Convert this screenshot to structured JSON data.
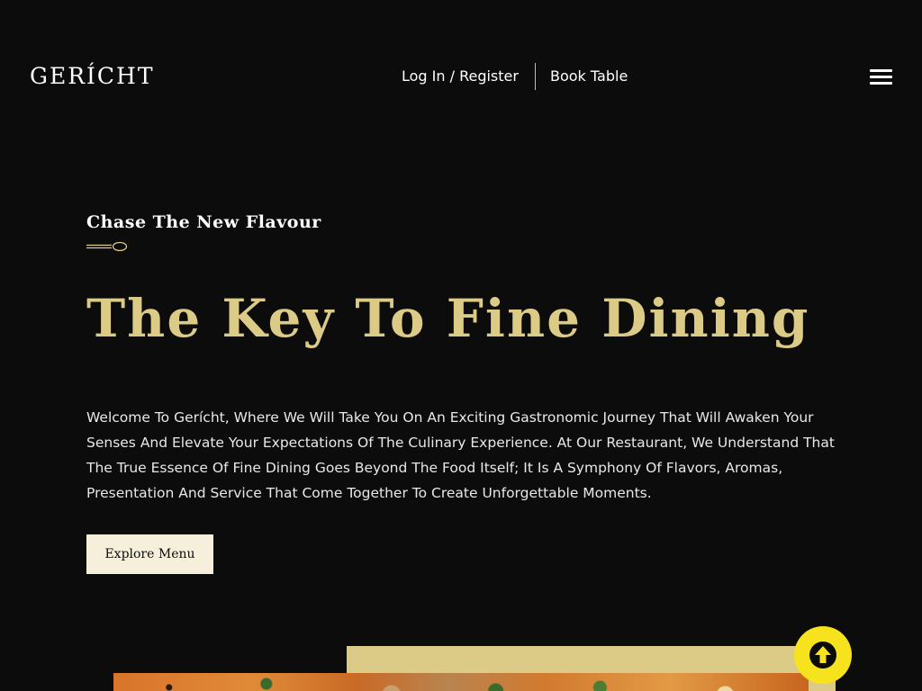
{
  "navbar": {
    "logo": "GERÍCHT",
    "login_label": "Log In / Register",
    "book_label": "Book Table",
    "menu_icon": "hamburger-menu-icon"
  },
  "hero": {
    "subtitle": "Chase The New Flavour",
    "spoon_icon": "spoon-icon",
    "title": "The Key To Fine Dining",
    "description": "Welcome To Gerícht, Where We Will Take You On An Exciting Gastronomic Journey That Will Awaken Your Senses And Elevate Your Expectations Of The Culinary Experience. At Our Restaurant, We Understand That The True Essence Of Fine Dining Goes Beyond The Food Itself; It Is A Symphony Of Flavors, Aromas, Presentation And Service That Come Together To Create Unforgettable Moments.",
    "button_label": "Explore Menu"
  },
  "scroll_top": {
    "icon": "arrow-up-circle-icon"
  },
  "colors": {
    "background": "#0c0c0c",
    "gold": "#dcca87",
    "button_bg": "#f5efdb",
    "scroll_button": "#f7e31d",
    "text": "#ffffff"
  }
}
